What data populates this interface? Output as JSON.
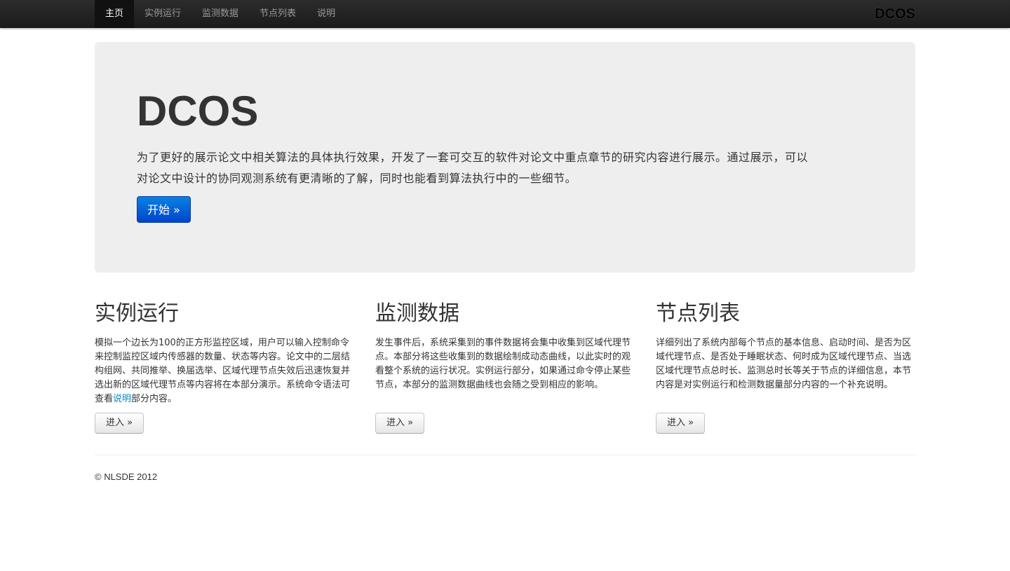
{
  "navbar": {
    "items": [
      {
        "label": "主页",
        "active": true
      },
      {
        "label": "实例运行",
        "active": false
      },
      {
        "label": "监测数据",
        "active": false
      },
      {
        "label": "节点列表",
        "active": false
      },
      {
        "label": "说明",
        "active": false
      }
    ],
    "brand": "DCOS"
  },
  "hero": {
    "title": "DCOS",
    "text_line1": "为了更好的展示论文中相关算法的具体执行效果，开发了一套可交互的软件对论文中重点章节的研究内容进行展示。通过展示，可以",
    "text_line2": "对论文中设计的协同观测系统有更清晰的了解，同时也能看到算法执行中的一些细节。",
    "button_label": "开始 »"
  },
  "sections": [
    {
      "title": "实例运行",
      "text_before_link": "模拟一个边长为100的正方形监控区域，用户可以输入控制命令来控制监控区域内传感器的数量、状态等内容。论文中的二层结构组网、共同推举、换届选举、区域代理节点失效后迅速恢复并选出新的区域代理节点等内容将在本部分演示。系统命令语法可查看",
      "link": "说明",
      "text_after_link": "部分内容。",
      "button_label": "进入 »"
    },
    {
      "title": "监测数据",
      "text": "发生事件后，系统采集到的事件数据将会集中收集到区域代理节点。本部分将这些收集到的数据绘制成动态曲线，以此实时的观看整个系统的运行状况。实例运行部分，如果通过命令停止某些节点，本部分的监测数据曲线也会随之受到相应的影响。",
      "button_label": "进入 »"
    },
    {
      "title": "节点列表",
      "text": "详细列出了系统内部每个节点的基本信息、启动时间、是否为区域代理节点、是否处于睡眠状态、何时成为区域代理节点、当选区域代理节点总时长、监测总时长等关于节点的详细信息，本节内容是对实例运行和检测数据量部分内容的一个补充说明。",
      "button_label": "进入 »"
    }
  ],
  "footer": {
    "text": "© NLSDE 2012"
  },
  "colors": {
    "navbar_bg": "#1b1b1b",
    "hero_bg": "#eeeeee",
    "primary_button": "#0055cc",
    "link": "#0088cc"
  }
}
